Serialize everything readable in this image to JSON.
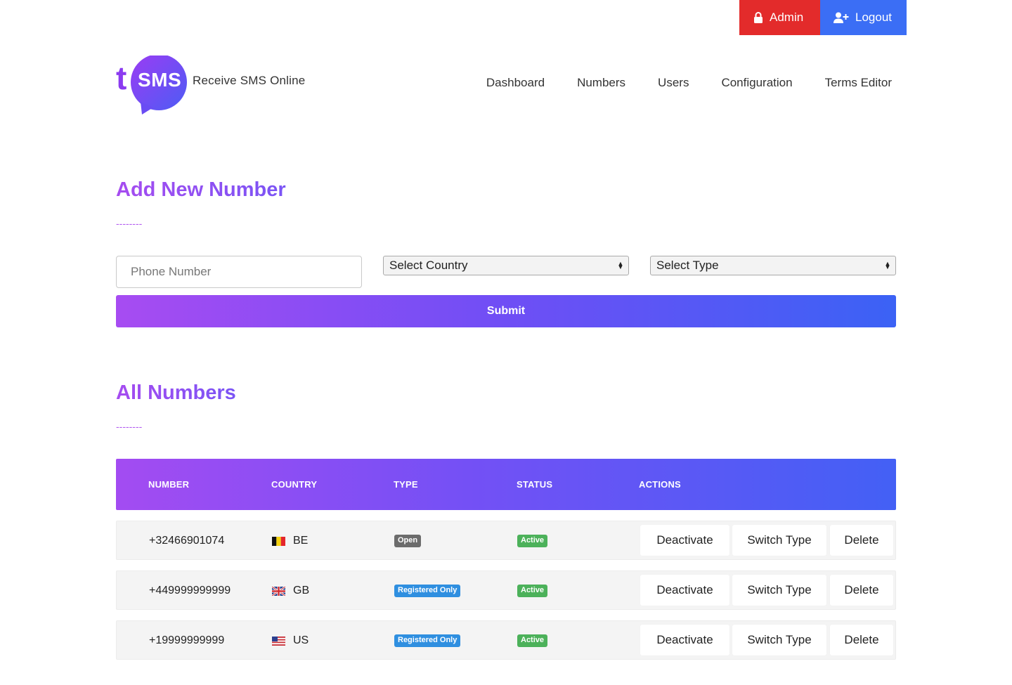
{
  "auth": {
    "admin_label": "Admin",
    "logout_label": "Logout"
  },
  "logo": {
    "letter": "t",
    "sms": "SMS",
    "tagline": "Receive SMS Online"
  },
  "nav": {
    "items": [
      "Dashboard",
      "Numbers",
      "Users",
      "Configuration",
      "Terms Editor"
    ]
  },
  "add_section": {
    "title": "Add New Number",
    "divider": "--------",
    "phone_placeholder": "Phone Number",
    "country_select": "Select Country",
    "type_select": "Select Type",
    "submit_label": "Submit"
  },
  "list_section": {
    "title": "All Numbers",
    "divider": "--------",
    "columns": [
      "NUMBER",
      "COUNTRY",
      "TYPE",
      "STATUS",
      "ACTIONS"
    ],
    "rows": [
      {
        "number": "+32466901074",
        "country": "BE",
        "type": "Open",
        "status": "Active"
      },
      {
        "number": "+449999999999",
        "country": "GB",
        "type": "Registered Only",
        "status": "Active"
      },
      {
        "number": "+19999999999",
        "country": "US",
        "type": "Registered Only",
        "status": "Active"
      }
    ],
    "actions": {
      "deactivate": "Deactivate",
      "switch_type": "Switch Type",
      "delete": "Delete"
    }
  },
  "colors": {
    "admin": "#e32b2b",
    "logout": "#3b6ef5",
    "accent_start": "#a74cf2",
    "accent_end": "#3b62f5",
    "badge_open": "#6c6c6c",
    "badge_registered": "#2f8fe0",
    "badge_active": "#4cb15a"
  }
}
